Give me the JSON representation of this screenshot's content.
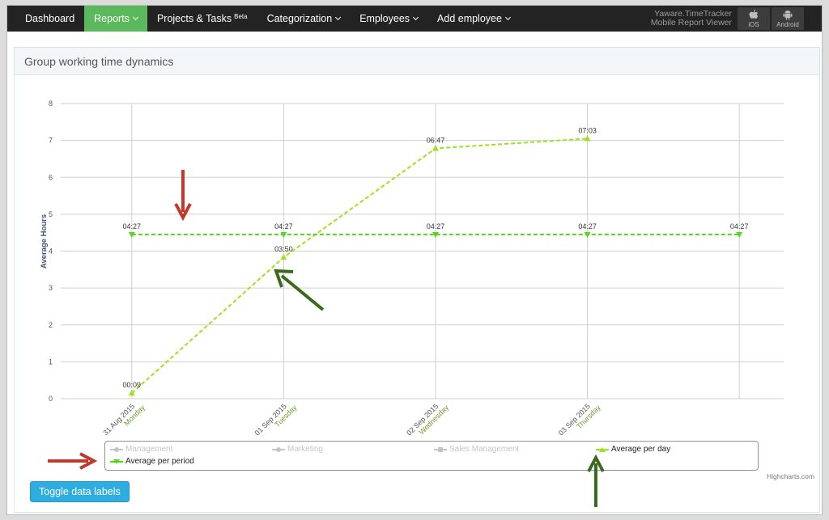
{
  "navbar": {
    "items": [
      {
        "label": "Dashboard",
        "active": false,
        "dropdown": false
      },
      {
        "label": "Reports",
        "active": true,
        "dropdown": true
      },
      {
        "label": "Projects & Tasks",
        "badge": "Beta",
        "active": false,
        "dropdown": false
      },
      {
        "label": "Categorization",
        "active": false,
        "dropdown": true
      },
      {
        "label": "Employees",
        "active": false,
        "dropdown": true
      },
      {
        "label": "Add employee",
        "active": false,
        "dropdown": true
      }
    ],
    "mobile_line1": "Yaware.TimeTracker",
    "mobile_line2": "Mobile Report Viewer",
    "ios_label": "iOS",
    "android_label": "Android",
    "bg_color": "#232323",
    "active_color": "#5cb85c"
  },
  "panel": {
    "title": "Group working time dynamics"
  },
  "chart_data": {
    "type": "line",
    "ylabel": "Average Hours",
    "ylim": [
      0,
      8
    ],
    "yticks": [
      0,
      1,
      2,
      3,
      4,
      5,
      6,
      7,
      8
    ],
    "grid": true,
    "x_dates": [
      "31 Aug 2015",
      "01 Sep 2015",
      "02 Sep 2015",
      "03 Sep 2015",
      ""
    ],
    "x_days": [
      "Monday",
      "Tuesday",
      "Wednesday",
      "Thursday",
      ""
    ],
    "series": [
      {
        "name": "Average per day",
        "color": "#9be31d",
        "marker": "triangle",
        "dash": true,
        "values": [
          0.15,
          3.833,
          6.783,
          7.05,
          null
        ],
        "labels": [
          "00:09",
          "03:50",
          "06:47",
          "07:03",
          ""
        ]
      },
      {
        "name": "Average per period",
        "color": "#55d81c",
        "marker": "triangle-down",
        "dash": true,
        "values": [
          4.45,
          4.45,
          4.45,
          4.45,
          4.45
        ],
        "labels": [
          "04:27",
          "04:27",
          "04:27",
          "04:27",
          "04:27"
        ]
      }
    ]
  },
  "legend": {
    "items": [
      {
        "label": "Management",
        "visible": false
      },
      {
        "label": "Marketing",
        "visible": false
      },
      {
        "label": "Sales Management",
        "visible": false
      },
      {
        "label": "Average per day",
        "visible": true
      },
      {
        "label": "Average per period",
        "visible": true
      }
    ]
  },
  "credits": "Highcharts.com",
  "toggle_button": "Toggle data labels",
  "annotation_colors": {
    "red": "#c0392b",
    "green": "#3a6b1d"
  }
}
